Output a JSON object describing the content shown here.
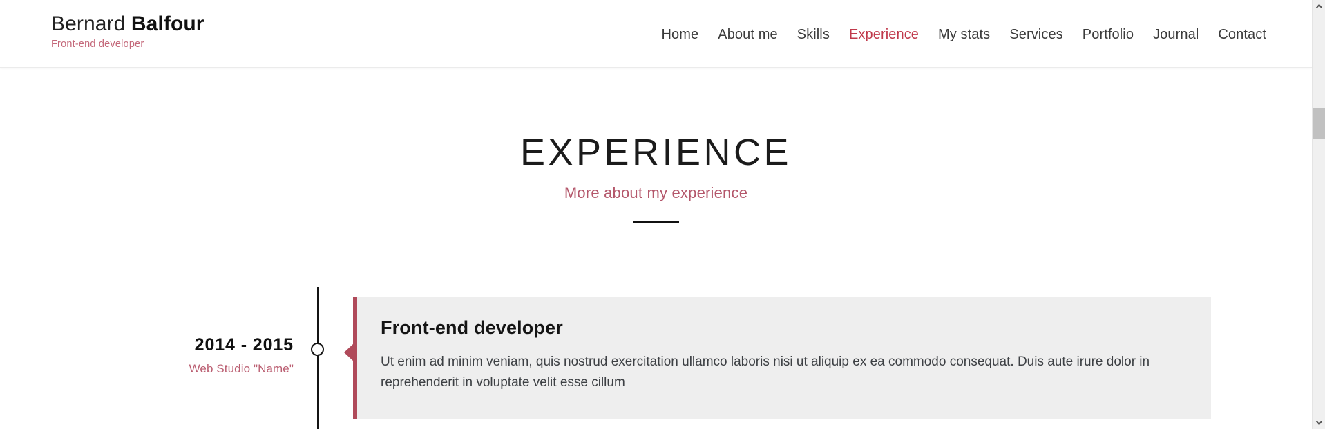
{
  "brand": {
    "first_name": "Bernard",
    "last_name": "Balfour",
    "role": "Front-end developer"
  },
  "nav": {
    "items": [
      {
        "label": "Home",
        "active": false
      },
      {
        "label": "About me",
        "active": false
      },
      {
        "label": "Skills",
        "active": false
      },
      {
        "label": "Experience",
        "active": true
      },
      {
        "label": "My stats",
        "active": false
      },
      {
        "label": "Services",
        "active": false
      },
      {
        "label": "Portfolio",
        "active": false
      },
      {
        "label": "Journal",
        "active": false
      },
      {
        "label": "Contact",
        "active": false
      }
    ]
  },
  "section": {
    "title": "EXPERIENCE",
    "subtitle": "More about my experience"
  },
  "timeline": {
    "entries": [
      {
        "date": "2014 - 2015",
        "company": "Web Studio \"Name\"",
        "title": "Front-end developer",
        "text": "Ut enim ad minim veniam, quis nostrud exercitation ullamco laboris nisi ut aliquip ex ea commodo consequat. Duis aute irure dolor in reprehenderit in voluptate velit esse cillum"
      }
    ]
  },
  "colors": {
    "accent_rose": "#c4687a",
    "accent_active": "#c0394b",
    "card_border": "#b04a5a",
    "card_bg": "#eeeeee",
    "text_dark": "#141414",
    "scrollbar_thumb": "#c1c1c1"
  },
  "scrollbar": {
    "up_arrow_icon": "chevron-up-icon",
    "down_arrow_icon": "chevron-down-icon"
  }
}
